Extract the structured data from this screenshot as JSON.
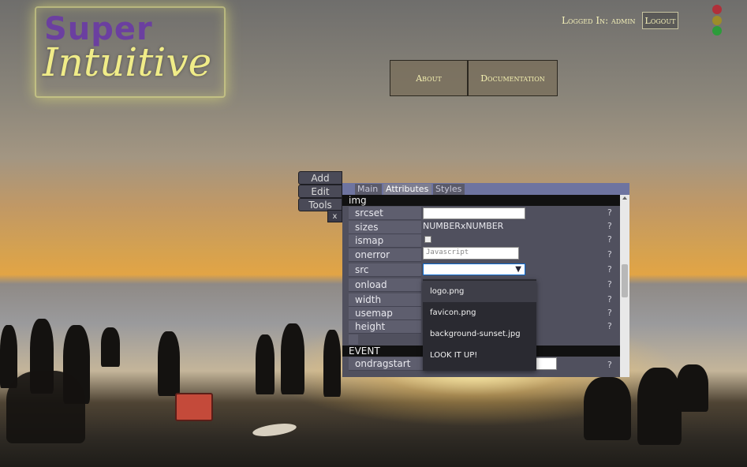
{
  "header": {
    "logo_top": "Super",
    "logo_bottom": "Intuitive",
    "logged_in": "Logged In: admin",
    "logout": "Logout"
  },
  "nav": {
    "about": "About",
    "documentation": "Documentation"
  },
  "side_menu": {
    "add": "Add",
    "edit": "Edit",
    "tools": "Tools",
    "close": "x"
  },
  "panel": {
    "tabs": [
      "Main",
      "Attributes",
      "Styles"
    ],
    "active_tab": "Attributes",
    "element_section": "img",
    "event_section": "EVENT",
    "attributes": [
      {
        "name": "srcset",
        "help": "?"
      },
      {
        "name": "sizes",
        "value": "NUMBERxNUMBER",
        "help": "?"
      },
      {
        "name": "ismap",
        "help": "?"
      },
      {
        "name": "onerror",
        "placeholder": "Javascript",
        "help": "?"
      },
      {
        "name": "src",
        "help": "?"
      },
      {
        "name": "onload",
        "help": "?"
      },
      {
        "name": "width",
        "help": "?"
      },
      {
        "name": "usemap",
        "help": "?"
      },
      {
        "name": "height",
        "help": "?"
      }
    ],
    "events": [
      {
        "name": "ondragstart",
        "help": "?"
      }
    ]
  },
  "src_dropdown": {
    "options": [
      "logo.png",
      "favicon.png",
      "background-sunset.jpg",
      "LOOK IT UP!"
    ],
    "highlighted": "logo.png"
  },
  "colors": {
    "accent_yellow": "#f0ec88",
    "logo_purple": "#6b3fa0",
    "panel_bg": "#50505e",
    "status_red": "#b0303a",
    "status_amber": "#9c8c2a",
    "status_green": "#2c9c3a"
  }
}
